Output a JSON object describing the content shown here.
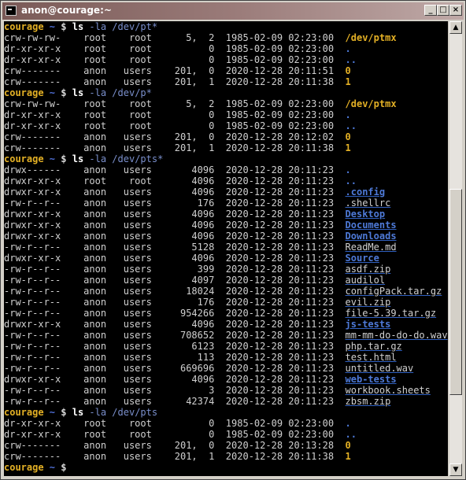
{
  "window": {
    "title": "anon@courage:~",
    "buttons": {
      "minimize": "_",
      "maximize": "□",
      "close": "×"
    }
  },
  "scrollbar": {
    "up": "▲",
    "down": "▼",
    "thumb_start": 0.36,
    "thumb_size": 0.48
  },
  "prompt": {
    "user": "courage",
    "dir": "~",
    "symbol": "$"
  },
  "lines": [
    {
      "type": "prompt",
      "cmd": "ls",
      "args": "-la /dev/pt*",
      "args_style": "arg"
    },
    {
      "type": "entry",
      "perms": "crw-rw-rw-",
      "owner": "root",
      "group": "root",
      "size": "5,  2",
      "date": "1985-02-09 02:23:00",
      "name": "/dev/ptmx",
      "style": "dev",
      "ul": false
    },
    {
      "type": "entry",
      "perms": "dr-xr-xr-x",
      "owner": "root",
      "group": "root",
      "size": "0",
      "date": "1985-02-09 02:23:00",
      "name": ".",
      "style": "dir",
      "ul": false
    },
    {
      "type": "entry",
      "perms": "dr-xr-xr-x",
      "owner": "root",
      "group": "root",
      "size": "0",
      "date": "1985-02-09 02:23:00",
      "name": "..",
      "style": "dir",
      "ul": false
    },
    {
      "type": "entry",
      "perms": "crw-------",
      "owner": "anon",
      "group": "users",
      "size": "201,  0",
      "date": "2020-12-28 20:11:51",
      "name": "0",
      "style": "dev",
      "ul": false
    },
    {
      "type": "entry",
      "perms": "crw-------",
      "owner": "anon",
      "group": "users",
      "size": "201,  1",
      "date": "2020-12-28 20:11:38",
      "name": "1",
      "style": "dev",
      "ul": false
    },
    {
      "type": "prompt",
      "cmd": "ls",
      "args": "-la /dev/p*",
      "args_style": "arg"
    },
    {
      "type": "entry",
      "perms": "crw-rw-rw-",
      "owner": "root",
      "group": "root",
      "size": "5,  2",
      "date": "1985-02-09 02:23:00",
      "name": "/dev/ptmx",
      "style": "dev",
      "ul": false
    },
    {
      "type": "entry",
      "perms": "dr-xr-xr-x",
      "owner": "root",
      "group": "root",
      "size": "0",
      "date": "1985-02-09 02:23:00",
      "name": ".",
      "style": "dir",
      "ul": false
    },
    {
      "type": "entry",
      "perms": "dr-xr-xr-x",
      "owner": "root",
      "group": "root",
      "size": "0",
      "date": "1985-02-09 02:23:00",
      "name": "..",
      "style": "dir",
      "ul": false
    },
    {
      "type": "entry",
      "perms": "crw-------",
      "owner": "anon",
      "group": "users",
      "size": "201,  0",
      "date": "2020-12-28 20:12:02",
      "name": "0",
      "style": "dev",
      "ul": false
    },
    {
      "type": "entry",
      "perms": "crw-------",
      "owner": "anon",
      "group": "users",
      "size": "201,  1",
      "date": "2020-12-28 20:11:38",
      "name": "1",
      "style": "dev",
      "ul": false
    },
    {
      "type": "prompt",
      "cmd": "ls",
      "args": "-la /dev/pts*",
      "args_style": "arg"
    },
    {
      "type": "entry",
      "perms": "drwx------",
      "owner": "anon",
      "group": "users",
      "size": "4096",
      "date": "2020-12-28 20:11:23",
      "name": ".",
      "style": "dir",
      "ul": false
    },
    {
      "type": "entry",
      "perms": "drwxr-xr-x",
      "owner": "root",
      "group": "root",
      "size": "4096",
      "date": "2020-12-28 20:11:23",
      "name": "..",
      "style": "dir",
      "ul": false
    },
    {
      "type": "entry",
      "perms": "drwxr-xr-x",
      "owner": "anon",
      "group": "users",
      "size": "4096",
      "date": "2020-12-28 20:11:23",
      "name": ".config",
      "style": "dir",
      "ul": true
    },
    {
      "type": "entry",
      "perms": "-rw-r--r--",
      "owner": "anon",
      "group": "users",
      "size": "176",
      "date": "2020-12-28 20:11:23",
      "name": ".shellrc",
      "style": "file",
      "ul": true
    },
    {
      "type": "entry",
      "perms": "drwxr-xr-x",
      "owner": "anon",
      "group": "users",
      "size": "4096",
      "date": "2020-12-28 20:11:23",
      "name": "Desktop",
      "style": "dir",
      "ul": true
    },
    {
      "type": "entry",
      "perms": "drwxr-xr-x",
      "owner": "anon",
      "group": "users",
      "size": "4096",
      "date": "2020-12-28 20:11:23",
      "name": "Documents",
      "style": "dir",
      "ul": true
    },
    {
      "type": "entry",
      "perms": "drwxr-xr-x",
      "owner": "anon",
      "group": "users",
      "size": "4096",
      "date": "2020-12-28 20:11:23",
      "name": "Downloads",
      "style": "dir",
      "ul": true
    },
    {
      "type": "entry",
      "perms": "-rw-r--r--",
      "owner": "anon",
      "group": "users",
      "size": "5128",
      "date": "2020-12-28 20:11:23",
      "name": "ReadMe.md",
      "style": "file",
      "ul": true
    },
    {
      "type": "entry",
      "perms": "drwxr-xr-x",
      "owner": "anon",
      "group": "users",
      "size": "4096",
      "date": "2020-12-28 20:11:23",
      "name": "Source",
      "style": "dir",
      "ul": true
    },
    {
      "type": "entry",
      "perms": "-rw-r--r--",
      "owner": "anon",
      "group": "users",
      "size": "399",
      "date": "2020-12-28 20:11:23",
      "name": "asdf.zip",
      "style": "file",
      "ul": true
    },
    {
      "type": "entry",
      "perms": "-rw-r--r--",
      "owner": "anon",
      "group": "users",
      "size": "4097",
      "date": "2020-12-28 20:11:23",
      "name": "audilol",
      "style": "file",
      "ul": true
    },
    {
      "type": "entry",
      "perms": "-rw-r--r--",
      "owner": "anon",
      "group": "users",
      "size": "18024",
      "date": "2020-12-28 20:11:23",
      "name": "configPack.tar.gz",
      "style": "file",
      "ul": true
    },
    {
      "type": "entry",
      "perms": "-rw-r--r--",
      "owner": "anon",
      "group": "users",
      "size": "176",
      "date": "2020-12-28 20:11:23",
      "name": "evil.zip",
      "style": "file",
      "ul": true
    },
    {
      "type": "entry",
      "perms": "-rw-r--r--",
      "owner": "anon",
      "group": "users",
      "size": "954266",
      "date": "2020-12-28 20:11:23",
      "name": "file-5.39.tar.gz",
      "style": "file",
      "ul": true
    },
    {
      "type": "entry",
      "perms": "drwxr-xr-x",
      "owner": "anon",
      "group": "users",
      "size": "4096",
      "date": "2020-12-28 20:11:23",
      "name": "js-tests",
      "style": "dir",
      "ul": true
    },
    {
      "type": "entry",
      "perms": "-rw-r--r--",
      "owner": "anon",
      "group": "users",
      "size": "708652",
      "date": "2020-12-28 20:11:23",
      "name": "mm-mm-do-do-do.wav",
      "style": "file",
      "ul": true
    },
    {
      "type": "entry",
      "perms": "-rw-r--r--",
      "owner": "anon",
      "group": "users",
      "size": "6123",
      "date": "2020-12-28 20:11:23",
      "name": "php.tar.gz",
      "style": "file",
      "ul": true
    },
    {
      "type": "entry",
      "perms": "-rw-r--r--",
      "owner": "anon",
      "group": "users",
      "size": "113",
      "date": "2020-12-28 20:11:23",
      "name": "test.html",
      "style": "file",
      "ul": true
    },
    {
      "type": "entry",
      "perms": "-rw-r--r--",
      "owner": "anon",
      "group": "users",
      "size": "669696",
      "date": "2020-12-28 20:11:23",
      "name": "untitled.wav",
      "style": "file",
      "ul": true
    },
    {
      "type": "entry",
      "perms": "drwxr-xr-x",
      "owner": "anon",
      "group": "users",
      "size": "4096",
      "date": "2020-12-28 20:11:23",
      "name": "web-tests",
      "style": "dir",
      "ul": true
    },
    {
      "type": "entry",
      "perms": "-rw-r--r--",
      "owner": "anon",
      "group": "users",
      "size": "3",
      "date": "2020-12-28 20:11:23",
      "name": "workbook.sheets",
      "style": "file",
      "ul": true
    },
    {
      "type": "entry",
      "perms": "-rw-r--r--",
      "owner": "anon",
      "group": "users",
      "size": "42374",
      "date": "2020-12-28 20:11:23",
      "name": "zbsm.zip",
      "style": "file",
      "ul": true
    },
    {
      "type": "prompt",
      "cmd": "ls",
      "args": "-la /dev/pts",
      "args_style": "arg"
    },
    {
      "type": "entry",
      "perms": "dr-xr-xr-x",
      "owner": "root",
      "group": "root",
      "size": "0",
      "date": "1985-02-09 02:23:00",
      "name": ".",
      "style": "dir",
      "ul": false
    },
    {
      "type": "entry",
      "perms": "dr-xr-xr-x",
      "owner": "root",
      "group": "root",
      "size": "0",
      "date": "1985-02-09 02:23:00",
      "name": "..",
      "style": "dir",
      "ul": false
    },
    {
      "type": "entry",
      "perms": "crw-------",
      "owner": "anon",
      "group": "users",
      "size": "201,  0",
      "date": "2020-12-28 20:13:28",
      "name": "0",
      "style": "dev",
      "ul": false
    },
    {
      "type": "entry",
      "perms": "crw-------",
      "owner": "anon",
      "group": "users",
      "size": "201,  1",
      "date": "2020-12-28 20:11:38",
      "name": "1",
      "style": "dev",
      "ul": false
    },
    {
      "type": "prompt",
      "cmd": "",
      "args": "",
      "args_style": "arg"
    }
  ]
}
